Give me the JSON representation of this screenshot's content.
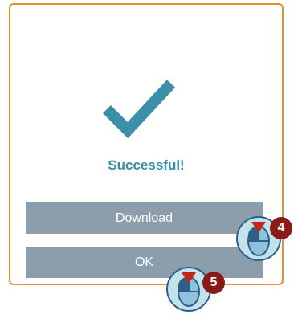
{
  "dialog": {
    "status_text": "Successful!",
    "download_label": "Download",
    "ok_label": "OK"
  },
  "callouts": [
    {
      "step": "4",
      "target": "download"
    },
    {
      "step": "5",
      "target": "ok"
    }
  ],
  "colors": {
    "dialog_border": "#e6912c",
    "checkmark": "#3b8fa8",
    "button_bg": "#8c9eac",
    "badge_bg": "#8b1a16"
  }
}
